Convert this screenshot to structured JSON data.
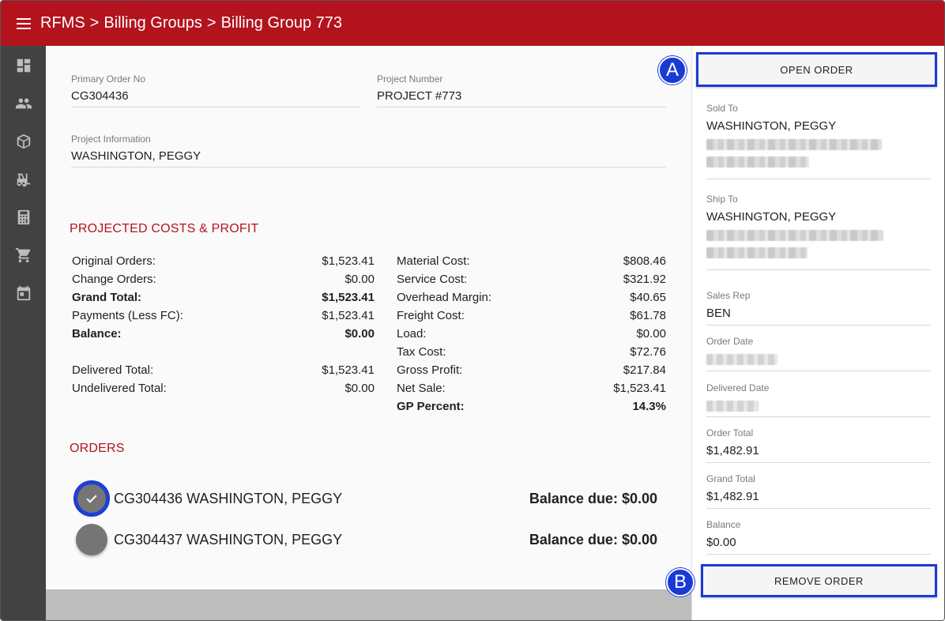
{
  "breadcrumb": {
    "root": "RFMS",
    "separator": ">",
    "section": "Billing Groups",
    "current": "Billing Group 773"
  },
  "fields": {
    "primary_order_no": {
      "label": "Primary Order No",
      "value": "CG304436"
    },
    "project_number": {
      "label": "Project Number",
      "value": "PROJECT #773"
    },
    "project_information": {
      "label": "Project Information",
      "value": "WASHINGTON, PEGGY"
    }
  },
  "costs": {
    "title": "PROJECTED COSTS & PROFIT",
    "left": [
      {
        "label": "Original Orders:",
        "value": "$1,523.41",
        "bold": false
      },
      {
        "label": "Change Orders:",
        "value": "$0.00",
        "bold": false
      },
      {
        "label": "Grand Total:",
        "value": "$1,523.41",
        "bold": true
      },
      {
        "label": "Payments (Less FC):",
        "value": "$1,523.41",
        "bold": false
      },
      {
        "label": "Balance:",
        "value": "$0.00",
        "bold": true
      },
      {
        "label": "Delivered Total:",
        "value": "$1,523.41",
        "bold": false,
        "gap": true
      },
      {
        "label": "Undelivered Total:",
        "value": "$0.00",
        "bold": false
      }
    ],
    "right": [
      {
        "label": "Material Cost:",
        "value": "$808.46",
        "bold": false
      },
      {
        "label": "Service Cost:",
        "value": "$321.92",
        "bold": false
      },
      {
        "label": "Overhead Margin:",
        "value": "$40.65",
        "bold": false
      },
      {
        "label": "Freight Cost:",
        "value": "$61.78",
        "bold": false
      },
      {
        "label": "Load:",
        "value": "$0.00",
        "bold": false
      },
      {
        "label": "Tax Cost:",
        "value": "$72.76",
        "bold": false
      },
      {
        "label": "Gross Profit:",
        "value": "$217.84",
        "bold": false
      },
      {
        "label": "Net Sale:",
        "value": "$1,523.41",
        "bold": false
      },
      {
        "label": "GP Percent:",
        "value": "14.3%",
        "bold": true
      }
    ]
  },
  "orders": {
    "title": "ORDERS",
    "items": [
      {
        "name": "CG304436 WASHINGTON, PEGGY",
        "balance": "Balance due: $0.00",
        "selected": true
      },
      {
        "name": "CG304437 WASHINGTON, PEGGY",
        "balance": "Balance due: $0.00",
        "selected": false
      }
    ]
  },
  "panel": {
    "open_order_label": "OPEN ORDER",
    "remove_order_label": "REMOVE ORDER",
    "sold_to": {
      "label": "Sold To",
      "value": "WASHINGTON, PEGGY"
    },
    "ship_to": {
      "label": "Ship To",
      "value": "WASHINGTON, PEGGY"
    },
    "sales_rep": {
      "label": "Sales Rep",
      "value": "BEN"
    },
    "order_date": {
      "label": "Order Date"
    },
    "delivered_date": {
      "label": "Delivered Date"
    },
    "order_total": {
      "label": "Order Total",
      "value": "$1,482.91"
    },
    "grand_total": {
      "label": "Grand Total",
      "value": "$1,482.91"
    },
    "balance": {
      "label": "Balance",
      "value": "$0.00"
    }
  },
  "badges": {
    "a": "A",
    "b": "B"
  },
  "nav_icons": [
    "dashboard-icon",
    "people-icon",
    "package-icon",
    "forklift-icon",
    "calculator-icon",
    "cart-icon",
    "calendar-icon"
  ],
  "colors": {
    "brand": "#b3131d",
    "highlight": "#1a3ad6",
    "rail": "#424242"
  }
}
